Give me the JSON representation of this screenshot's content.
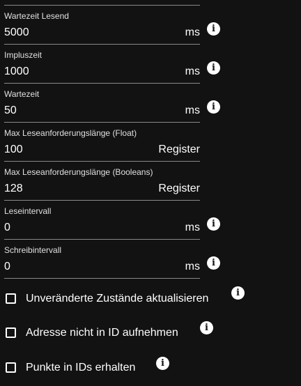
{
  "fields": [
    {
      "label": "Wartezeit Lesend",
      "value": "5000",
      "unit": "ms",
      "info": true
    },
    {
      "label": "Impluszeit",
      "value": "1000",
      "unit": "ms",
      "info": true
    },
    {
      "label": "Wartezeit",
      "value": "50",
      "unit": "ms",
      "info": true
    },
    {
      "label": "Max Leseanforderungslänge (Float)",
      "value": "100",
      "unit": "Register",
      "info": false
    },
    {
      "label": "Max Leseanforderungslänge (Booleans)",
      "value": "128",
      "unit": "Register",
      "info": false
    },
    {
      "label": "Leseintervall",
      "value": "0",
      "unit": "ms",
      "info": true
    },
    {
      "label": "Schreibintervall",
      "value": "0",
      "unit": "ms",
      "info": true
    }
  ],
  "checkboxes": [
    {
      "label": "Unveränderte Zustände aktualisieren",
      "checked": false
    },
    {
      "label": "Adresse nicht in ID aufnehmen",
      "checked": false
    },
    {
      "label": "Punkte in IDs erhalten",
      "checked": false
    }
  ],
  "info_glyph": "i",
  "icons": {
    "info": "info-icon",
    "checkbox": "checkbox-icon"
  },
  "colors": {
    "background": "#121212",
    "text": "#ffffff",
    "underline": "#8a8a8a"
  }
}
